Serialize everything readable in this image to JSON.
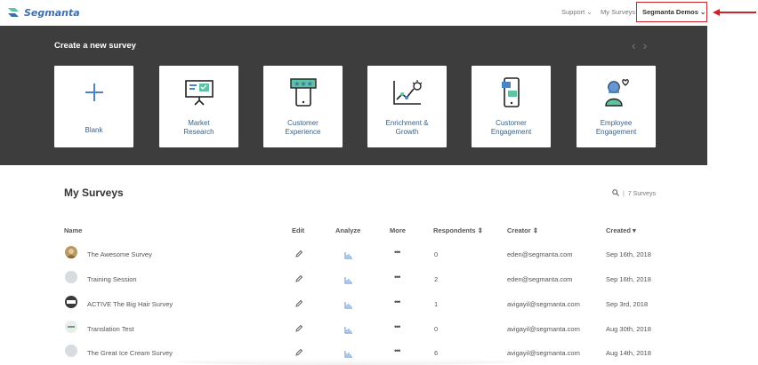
{
  "header": {
    "logo_text": "Segmanta",
    "nav": {
      "support": "Support",
      "my_surveys": "My Surveys",
      "account": "Segmanta Demos"
    },
    "accent": "#c8252b"
  },
  "create": {
    "title": "Create a new survey",
    "templates": [
      {
        "label": "Blank",
        "icon": "plus-icon"
      },
      {
        "label": "Market\nResearch",
        "icon": "presentation-icon"
      },
      {
        "label": "Customer\nExperience",
        "icon": "phone-rating-icon"
      },
      {
        "label": "Enrichment &\nGrowth",
        "icon": "growth-chart-icon"
      },
      {
        "label": "Customer\nEngagement",
        "icon": "phone-engagement-icon"
      },
      {
        "label": "Employee\nEngagement",
        "icon": "employee-heart-icon"
      }
    ]
  },
  "surveys": {
    "title": "My Surveys",
    "count_text": "7 Surveys",
    "columns": {
      "name": "Name",
      "edit": "Edit",
      "analyze": "Analyze",
      "more": "More",
      "respondents": "Respondents",
      "creator": "Creator",
      "created": "Created"
    },
    "rows": [
      {
        "name": "The Awesome Survey",
        "respondents": "0",
        "creator": "eden@segmanta.com",
        "created": "Sep 16th, 2018"
      },
      {
        "name": "Training Session",
        "respondents": "2",
        "creator": "eden@segmanta.com",
        "created": "Sep 16th, 2018"
      },
      {
        "name": "ACTIVE The Big Hair Survey",
        "respondents": "1",
        "creator": "avigayil@segmanta.com",
        "created": "Sep 3rd, 2018"
      },
      {
        "name": "Translation Test",
        "respondents": "0",
        "creator": "avigayil@segmanta.com",
        "created": "Aug 30th, 2018"
      },
      {
        "name": "The Great Ice Cream Survey",
        "respondents": "6",
        "creator": "avigayil@segmanta.com",
        "created": "Aug 14th, 2018"
      }
    ]
  }
}
